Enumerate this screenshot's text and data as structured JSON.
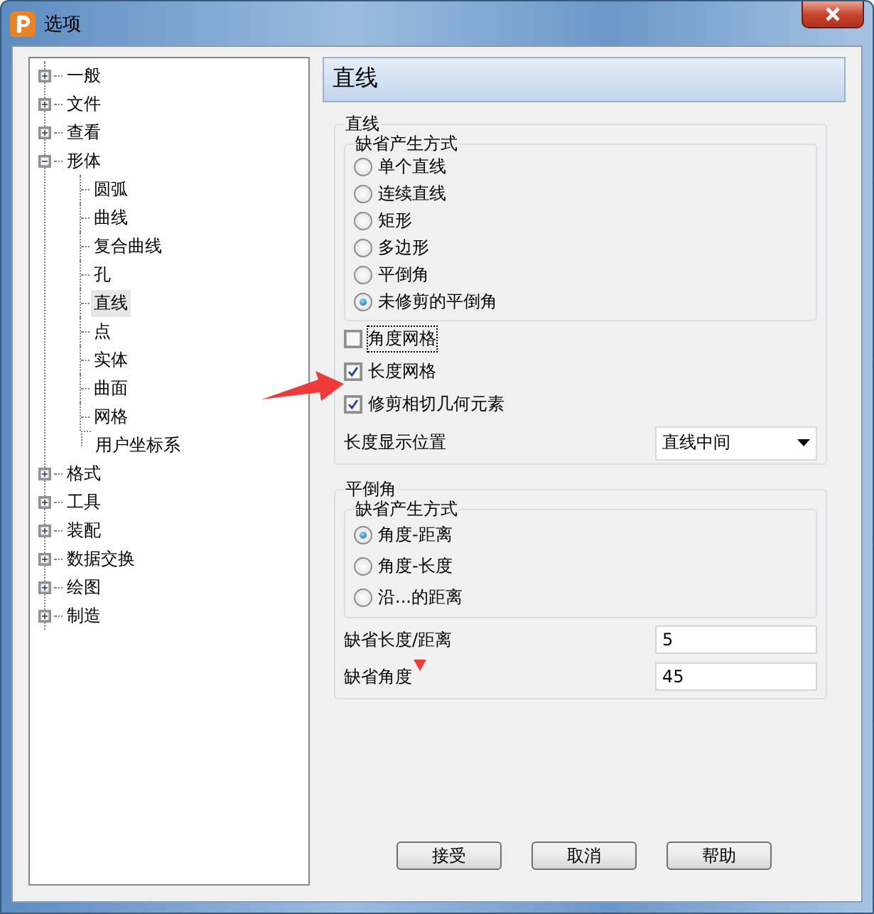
{
  "window": {
    "title": "选项"
  },
  "tree": [
    {
      "label": "一般",
      "expanded": false,
      "selected": false
    },
    {
      "label": "文件",
      "expanded": false,
      "selected": false
    },
    {
      "label": "查看",
      "expanded": false,
      "selected": false
    },
    {
      "label": "形体",
      "expanded": true,
      "selected": false,
      "children": [
        {
          "label": "圆弧",
          "selected": false
        },
        {
          "label": "曲线",
          "selected": false
        },
        {
          "label": "复合曲线",
          "selected": false
        },
        {
          "label": "孔",
          "selected": false
        },
        {
          "label": "直线",
          "selected": true
        },
        {
          "label": "点",
          "selected": false
        },
        {
          "label": "实体",
          "selected": false
        },
        {
          "label": "曲面",
          "selected": false
        },
        {
          "label": "网格",
          "selected": false
        },
        {
          "label": "用户坐标系",
          "selected": false
        }
      ]
    },
    {
      "label": "格式",
      "expanded": false,
      "selected": false
    },
    {
      "label": "工具",
      "expanded": false,
      "selected": false
    },
    {
      "label": "装配",
      "expanded": false,
      "selected": false
    },
    {
      "label": "数据交换",
      "expanded": false,
      "selected": false
    },
    {
      "label": "绘图",
      "expanded": false,
      "selected": false
    },
    {
      "label": "制造",
      "expanded": false,
      "selected": false
    }
  ],
  "page_header": "直线",
  "line_group": {
    "title": "直线",
    "method_group": {
      "title": "缺省产生方式",
      "options": [
        {
          "label": "单个直线",
          "selected": false
        },
        {
          "label": "连续直线",
          "selected": false
        },
        {
          "label": "矩形",
          "selected": false
        },
        {
          "label": "多边形",
          "selected": false
        },
        {
          "label": "平倒角",
          "selected": false
        },
        {
          "label": "未修剪的平倒角",
          "selected": true
        }
      ]
    },
    "checkboxes": [
      {
        "label": "角度网格",
        "checked": false,
        "focused": true
      },
      {
        "label": "长度网格",
        "checked": true,
        "focused": false
      },
      {
        "label": "修剪相切几何元素",
        "checked": true,
        "focused": false
      }
    ],
    "display_position": {
      "label": "长度显示位置",
      "value": "直线中间"
    }
  },
  "chamfer_group": {
    "title": "平倒角",
    "method_group": {
      "title": "缺省产生方式",
      "options": [
        {
          "label": "角度-距离",
          "selected": true
        },
        {
          "label": "角度-长度",
          "selected": false
        },
        {
          "label": "沿...的距离",
          "selected": false
        }
      ]
    },
    "fields": [
      {
        "label": "缺省长度/距离",
        "value": "5"
      },
      {
        "label": "缺省角度",
        "value": "45"
      }
    ]
  },
  "buttons": [
    "接受",
    "取消",
    "帮助"
  ]
}
